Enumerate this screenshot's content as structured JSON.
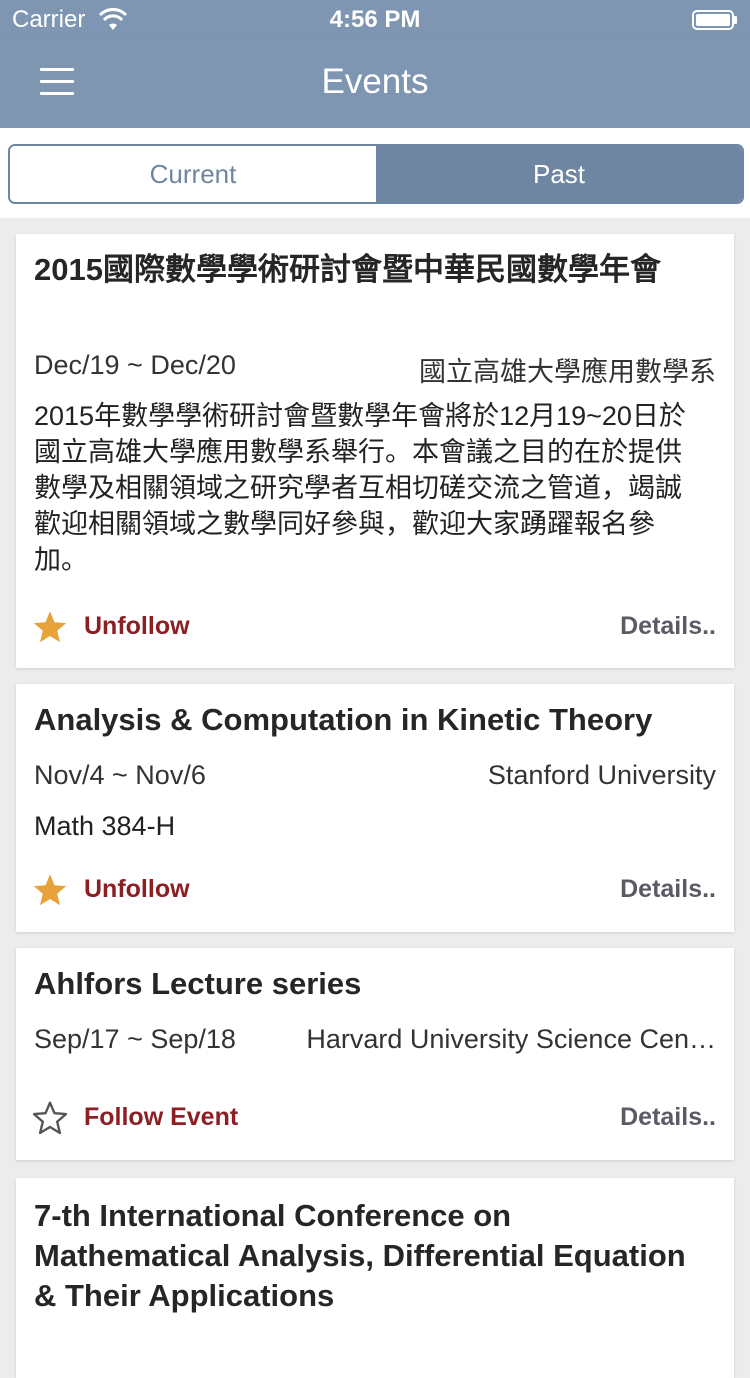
{
  "status": {
    "carrier": "Carrier",
    "time": "4:56 PM"
  },
  "nav": {
    "title": "Events",
    "menu_icon": "hamburger-menu-icon"
  },
  "tabs": {
    "current": "Current",
    "past": "Past",
    "selected": "Past"
  },
  "colors": {
    "nav": "#7e96b1",
    "accent": "#6e86a1",
    "follow": "#8c1f24",
    "star": "#e8a23a"
  },
  "events": [
    {
      "title": "2015國際數學學術研討會暨中華民國數學年會",
      "date": "Dec/19 ~ Dec/20",
      "venue": "國立高雄大學應用數學系",
      "desc": "2015年數學學術研討會暨數學年會將於12月19~20日於國立高雄大學應用數學系舉行。本會議之目的在於提供數學及相關領域之研究學者互相切磋交流之管道，竭誠歡迎相關領域之數學同好參與，歡迎大家踴躍報名參加。",
      "follow_label": "Unfollow",
      "followed": true,
      "details_label": "Details.."
    },
    {
      "title": "Analysis & Computation in Kinetic Theory",
      "date": "Nov/4 ~ Nov/6",
      "venue": "Stanford University",
      "desc": "Math 384-H",
      "follow_label": "Unfollow",
      "followed": true,
      "details_label": "Details.."
    },
    {
      "title": "Ahlfors Lecture series",
      "date": "Sep/17 ~ Sep/18",
      "venue": "Harvard University Science Cen…",
      "desc": "",
      "follow_label": "Follow Event",
      "followed": false,
      "details_label": "Details.."
    },
    {
      "title": "7-th International Conference on Mathematical Analysis, Differential Equation & Their Applications"
    }
  ]
}
